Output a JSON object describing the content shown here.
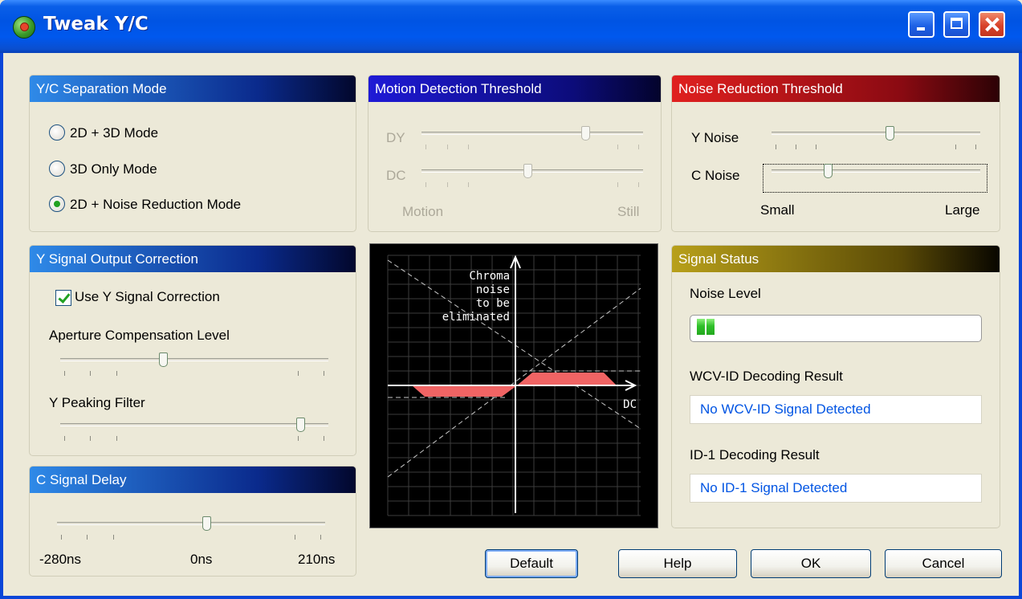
{
  "window": {
    "title": "Tweak Y/C",
    "controls": {
      "minimize": "minimize-icon",
      "maximize": "maximize-icon",
      "close": "close-icon"
    }
  },
  "yc_separation": {
    "header": "Y/C Separation Mode",
    "options": [
      {
        "label": "2D + 3D Mode",
        "selected": false
      },
      {
        "label": "3D Only Mode",
        "selected": false
      },
      {
        "label": "2D + Noise Reduction Mode",
        "selected": true
      }
    ]
  },
  "motion_detection": {
    "header": "Motion Detection Threshold",
    "dy_label": "DY",
    "dy_value": 0.75,
    "dc_label": "DC",
    "dc_value": 0.48,
    "min_label": "Motion",
    "max_label": "Still",
    "enabled": false
  },
  "noise_reduction": {
    "header": "Noise Reduction Threshold",
    "y_label": "Y Noise",
    "y_value": 0.57,
    "c_label": "C Noise",
    "c_value": 0.26,
    "min_label": "Small",
    "max_label": "Large"
  },
  "y_signal": {
    "header": "Y Signal Output Correction",
    "use_label": "Use Y Signal Correction",
    "use_checked": true,
    "aperture_label": "Aperture Compensation Level",
    "aperture_value": 0.38,
    "peaking_label": "Y Peaking Filter",
    "peaking_value": 0.91
  },
  "c_delay": {
    "header": "C Signal Delay",
    "value": 0.56,
    "min_label": "-280ns",
    "mid_label": "0ns",
    "max_label": "210ns"
  },
  "graph": {
    "ylabel_lines": [
      "Chroma",
      "noise",
      "to be",
      "eliminated"
    ],
    "xlabel": "DC",
    "fill_color": "#F06464"
  },
  "signal_status": {
    "header": "Signal Status",
    "noise_label": "Noise Level",
    "noise_level": 0.06,
    "wcv_label": "WCV-ID Decoding Result",
    "wcv_value": "No WCV-ID Signal Detected",
    "id1_label": "ID-1 Decoding Result",
    "id1_value": "No ID-1 Signal Detected"
  },
  "buttons": {
    "default": "Default",
    "help": "Help",
    "ok": "OK",
    "cancel": "Cancel"
  }
}
